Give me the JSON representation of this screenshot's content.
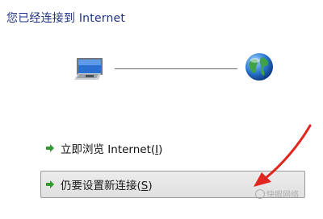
{
  "header": {
    "title": "您已经连接到 Internet"
  },
  "diagram": {
    "left_icon": "computer-icon",
    "right_icon": "internet-globe-icon"
  },
  "links": [
    {
      "icon": "green-arrow-icon",
      "label_before": "立即浏览 Internet(",
      "access_key": "I",
      "label_after": ")"
    },
    {
      "icon": "green-arrow-icon",
      "label_before": "仍要设置新连接(",
      "access_key": "S",
      "label_after": ")",
      "selected": true
    }
  ],
  "watermark": {
    "text": "快眼网络"
  },
  "colors": {
    "title": "#1e3287",
    "arrow": "#2f9b2f",
    "annotation_arrow": "#e0261f",
    "selection_border": "#9a9a9a"
  }
}
